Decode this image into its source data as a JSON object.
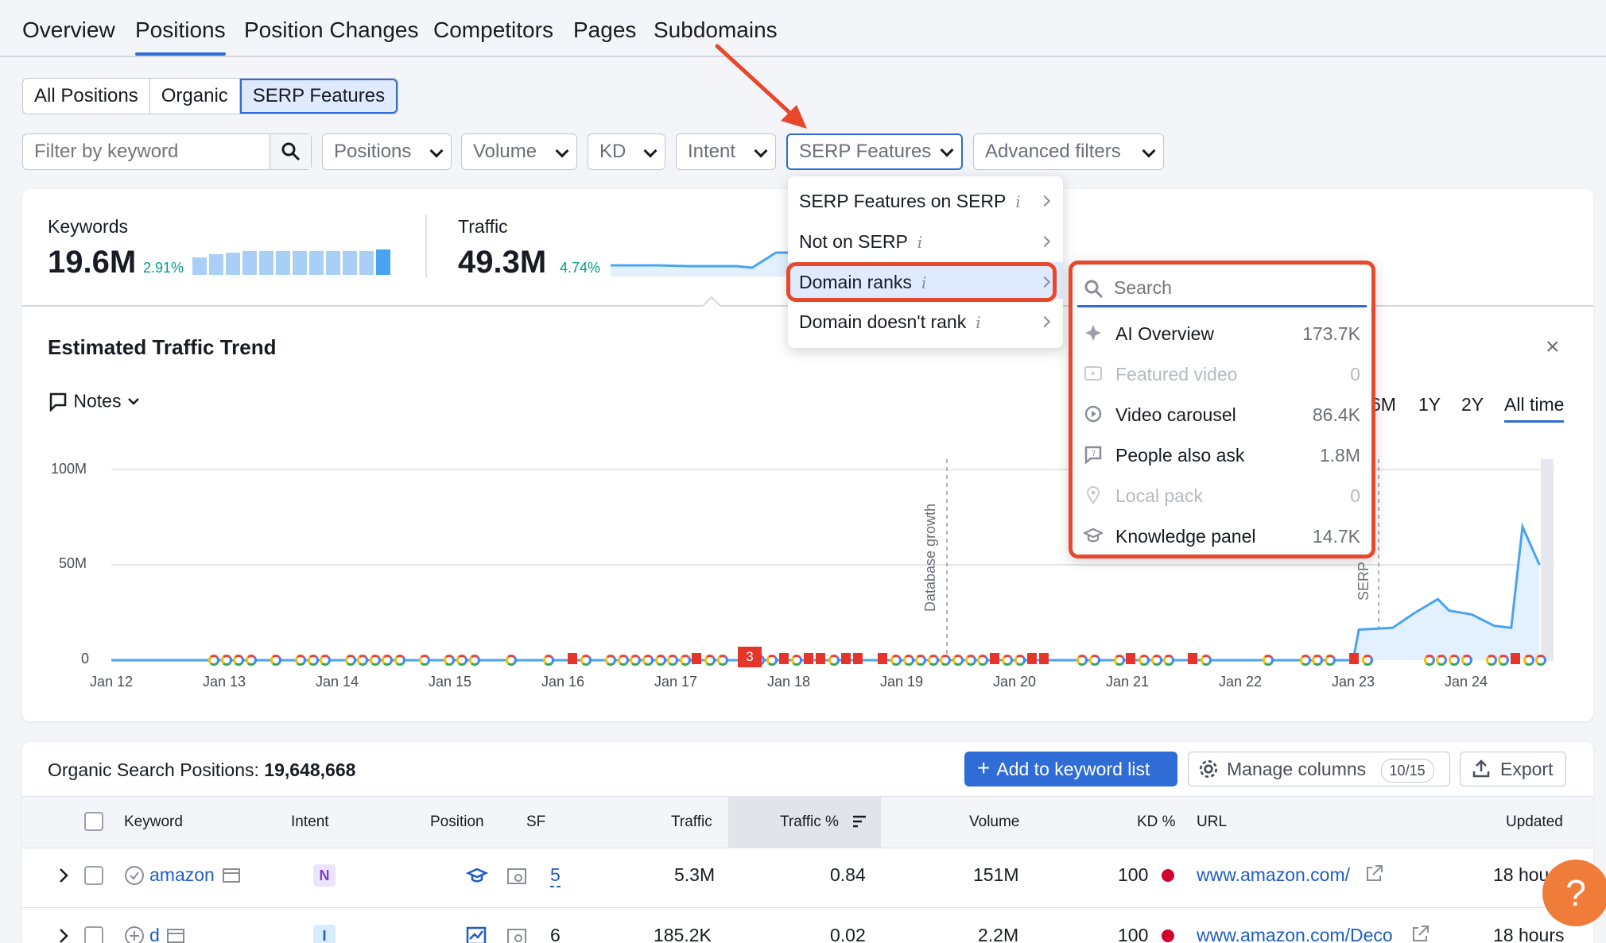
{
  "nav": {
    "tabs": [
      "Overview",
      "Positions",
      "Position Changes",
      "Competitors",
      "Pages",
      "Subdomains"
    ],
    "active": "Positions"
  },
  "segments": [
    "All Positions",
    "Organic",
    "SERP Features"
  ],
  "filters": {
    "keyword_placeholder": "Filter by keyword",
    "positions": "Positions",
    "volume": "Volume",
    "kd": "KD",
    "intent": "Intent",
    "serp": "SERP Features",
    "advanced": "Advanced filters"
  },
  "metrics": {
    "keywords_label": "Keywords",
    "keywords_value": "19.6M",
    "keywords_delta": "2.91%",
    "traffic_label": "Traffic",
    "traffic_value": "49.3M",
    "traffic_delta": "4.74%"
  },
  "serp_menu": {
    "items": [
      "SERP Features on SERP",
      "Not on SERP",
      "Domain ranks",
      "Domain doesn't rank"
    ],
    "info_glyph": "i"
  },
  "submenu": {
    "search_placeholder": "Search",
    "items": [
      {
        "label": "AI Overview",
        "count": "173.7K",
        "icon": "ai-overview-icon",
        "disabled": false
      },
      {
        "label": "Featured video",
        "count": "0",
        "icon": "featured-video-icon",
        "disabled": true
      },
      {
        "label": "Video carousel",
        "count": "86.4K",
        "icon": "video-carousel-icon",
        "disabled": false
      },
      {
        "label": "People also ask",
        "count": "1.8M",
        "icon": "people-also-ask-icon",
        "disabled": false
      },
      {
        "label": "Local pack",
        "count": "0",
        "icon": "local-pack-icon",
        "disabled": true
      },
      {
        "label": "Knowledge panel",
        "count": "14.7K",
        "icon": "knowledge-panel-icon",
        "disabled": false
      }
    ]
  },
  "trend": {
    "title": "Estimated Traffic Trend",
    "notes_label": "Notes",
    "periods": [
      "6M",
      "1Y",
      "2Y",
      "All time"
    ],
    "active_period": "All time",
    "annotation_db": "Database growth",
    "annotation_serp": "SERP",
    "flag_count": "3"
  },
  "chart_data": {
    "type": "area",
    "x": [
      "Jan 12",
      "Jan 13",
      "Jan 14",
      "Jan 15",
      "Jan 16",
      "Jan 17",
      "Jan 18",
      "Jan 19",
      "Jan 20",
      "Jan 21",
      "Jan 22",
      "Jan 23",
      "Jan 24"
    ],
    "y_ticks": [
      "100M",
      "50M",
      "0"
    ],
    "ylim": [
      0,
      100
    ],
    "series": [
      {
        "values": [
          0,
          0,
          0,
          0,
          0,
          0,
          0,
          0,
          0,
          0,
          0,
          1,
          27
        ]
      }
    ],
    "points": [
      [
        23.0,
        0
      ],
      [
        23.05,
        16
      ],
      [
        23.35,
        17
      ],
      [
        23.55,
        25
      ],
      [
        23.75,
        32
      ],
      [
        23.85,
        26
      ],
      [
        24.05,
        24
      ],
      [
        24.25,
        18
      ],
      [
        24.4,
        17
      ],
      [
        24.5,
        70
      ],
      [
        24.65,
        50
      ]
    ]
  },
  "table": {
    "title_prefix": "Organic Search Positions: ",
    "title_count": "19,648,668",
    "add_button": "Add to keyword list",
    "manage_button": "Manage columns",
    "manage_badge": "10/15",
    "export_button": "Export",
    "headers": [
      "Keyword",
      "Intent",
      "Position",
      "SF",
      "Traffic",
      "Traffic %",
      "Volume",
      "KD %",
      "URL",
      "Updated"
    ],
    "rows": [
      {
        "keyword": "amazon",
        "intent": "N",
        "sf": "5",
        "traffic": "5.3M",
        "traffic_pct": "0.84",
        "volume": "151M",
        "kd": "100",
        "url": "www.amazon.com/",
        "updated": "18 hou"
      },
      {
        "keyword": "d",
        "intent": "I",
        "sf": "6",
        "traffic": "185.2K",
        "traffic_pct": "0.02",
        "volume": "2.2M",
        "kd": "100",
        "url": "www.amazon.com/Deco",
        "updated": "18 hours"
      }
    ]
  },
  "help_glyph": "?",
  "colors": {
    "accent": "#2f6cd6",
    "highlight": "#e8472b",
    "series": "#4aa3f0"
  }
}
